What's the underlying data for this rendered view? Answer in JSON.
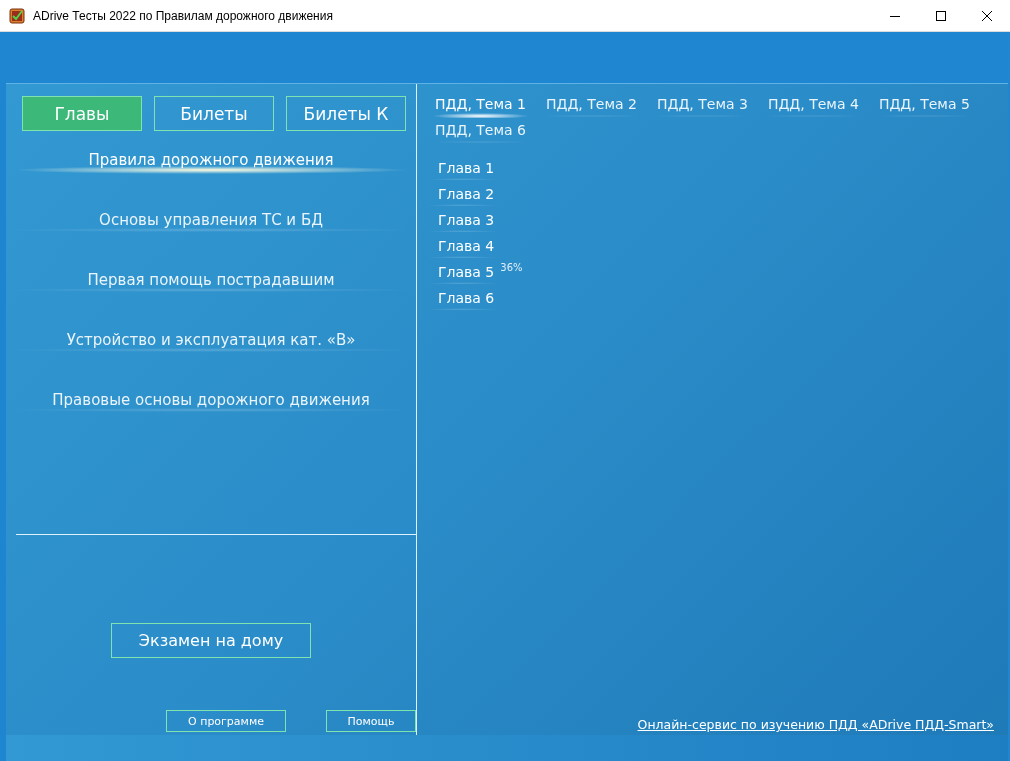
{
  "window": {
    "title": "ADrive Тесты 2022 по Правилам дорожного движения"
  },
  "mode_tabs": [
    {
      "label": "Главы",
      "selected": true
    },
    {
      "label": "Билеты",
      "selected": false
    },
    {
      "label": "Билеты К",
      "selected": false
    }
  ],
  "sections": [
    {
      "label": "Правила дорожного движения",
      "selected": true
    },
    {
      "label": "Основы управления ТС и БД",
      "selected": false
    },
    {
      "label": "Первая помощь пострадавшим",
      "selected": false
    },
    {
      "label": "Устройство и эксплуатация кат. «В»",
      "selected": false
    },
    {
      "label": "Правовые основы дорожного движения",
      "selected": false
    }
  ],
  "exam_button": "Экзамен на дому",
  "footer_buttons": [
    "О программе",
    "Помощь"
  ],
  "topics": [
    {
      "label": "ПДД, Тема 1",
      "selected": true
    },
    {
      "label": "ПДД, Тема 2",
      "selected": false
    },
    {
      "label": "ПДД, Тема 3",
      "selected": false
    },
    {
      "label": "ПДД, Тема 4",
      "selected": false
    },
    {
      "label": "ПДД, Тема 5",
      "selected": false
    },
    {
      "label": "ПДД, Тема 6",
      "selected": false
    }
  ],
  "chapters": [
    {
      "label": "Глава 1"
    },
    {
      "label": "Глава 2"
    },
    {
      "label": "Глава 3"
    },
    {
      "label": "Глава 4"
    },
    {
      "label": "Глава 5",
      "progress": "36%"
    },
    {
      "label": "Глава 6"
    }
  ],
  "online_link": "Онлайн-сервис по изучению ПДД «ADrive ПДД-Smart»"
}
